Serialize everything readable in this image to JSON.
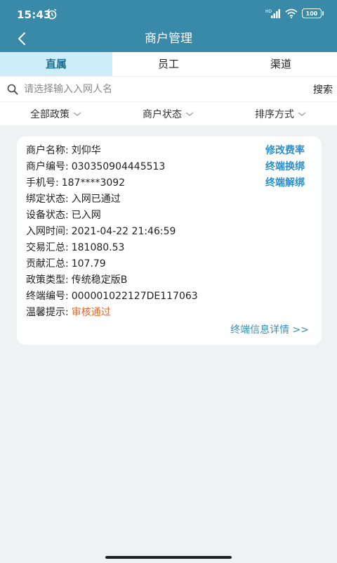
{
  "status_bar": {
    "time": "15:43",
    "battery": "100"
  },
  "header": {
    "title": "商户管理"
  },
  "tabs": [
    {
      "label": "直属",
      "active": true
    },
    {
      "label": "员工",
      "active": false
    },
    {
      "label": "渠道",
      "active": false
    }
  ],
  "search": {
    "placeholder": "请选择输入入网人名",
    "button": "搜索"
  },
  "filters": [
    "全部政策",
    "商户状态",
    "排序方式"
  ],
  "merchant": {
    "rows": [
      {
        "label": "商户名称:",
        "value": "刘仰华"
      },
      {
        "label": "商户编号:",
        "value": "030350904445513"
      },
      {
        "label": "手机号:",
        "value": "187****3092"
      },
      {
        "label": "绑定状态:",
        "value": " 入网已通过"
      },
      {
        "label": "设备状态:",
        "value": "已入网"
      },
      {
        "label": "入网时间:",
        "value": "2021-04-22 21:46:59"
      },
      {
        "label": "交易汇总:",
        "value": "181080.53"
      },
      {
        "label": "贡献汇总:",
        "value": "107.79"
      },
      {
        "label": "政策类型:",
        "value": "传统稳定版B"
      },
      {
        "label": "终端编号:",
        "value": "000001022127DE117063"
      },
      {
        "label": "温馨提示:",
        "value": "审核通过"
      }
    ],
    "actions": [
      "修改费率",
      "终端换绑",
      "终端解绑"
    ],
    "detail_link": "终端信息详情 >>",
    "colors": {
      "action": "#2d8ec9",
      "notice": "#e0672a"
    }
  },
  "colors": {
    "header": "#3989a8",
    "active_tab_bg": "#cdeef8"
  }
}
